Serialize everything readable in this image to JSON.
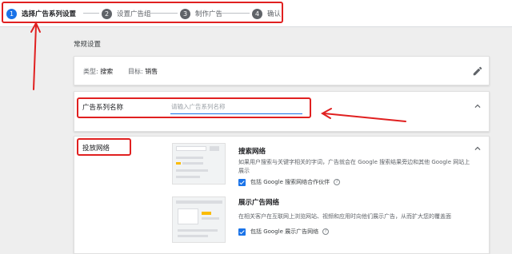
{
  "stepper": {
    "steps": [
      {
        "number": "1",
        "label": "选择广告系列设置",
        "active": true
      },
      {
        "number": "2",
        "label": "设置广告组",
        "active": false
      },
      {
        "number": "3",
        "label": "制作广告",
        "active": false
      },
      {
        "number": "4",
        "label": "确认",
        "active": false
      }
    ]
  },
  "general": {
    "section_title": "常规设置",
    "type_label": "类型:",
    "type_value": "搜索",
    "goal_label": "目标:",
    "goal_value": "销售",
    "edit_icon": "pencil-icon"
  },
  "campaign_name": {
    "label": "广告系列名称",
    "placeholder": "请输入广告系列名称",
    "value": "",
    "collapse_icon": "chevron-up-icon"
  },
  "networks": {
    "label": "投放网络",
    "collapse_icon": "chevron-up-icon",
    "search": {
      "title": "搜索网络",
      "description": "如果用户搜索与关键字相关的字词，广告就会在 Google 搜索结果旁边和其他 Google 网站上展示",
      "checkbox_label": "包括 Google 搜索网络合作伙伴",
      "checked": true
    },
    "display": {
      "title": "展示广告网络",
      "description": "在相关客户在互联网上浏览网站、视频和应用时向他们展示广告，从而扩大您的覆盖面",
      "checkbox_label": "包括 Google 展示广告网络",
      "checked": true
    }
  },
  "colors": {
    "primary": "#1a73e8",
    "annotation": "#e02020"
  }
}
